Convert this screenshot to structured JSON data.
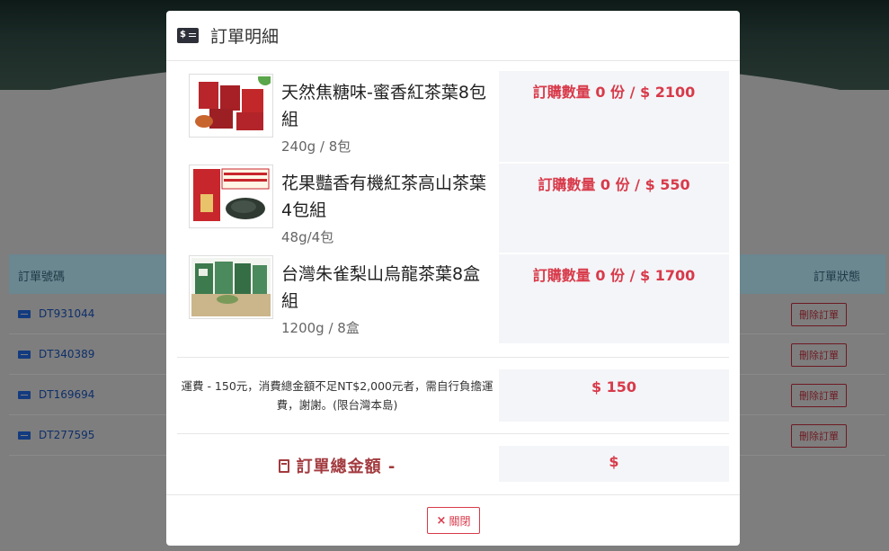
{
  "background": {
    "table_headers": {
      "order_no": "訂單號碼",
      "status": "訂單狀態"
    },
    "rows": [
      {
        "order_no": "DT931044",
        "action": "刪除訂單"
      },
      {
        "order_no": "DT340389",
        "action": "刪除訂單"
      },
      {
        "order_no": "DT169694",
        "action": "刪除訂單"
      },
      {
        "order_no": "DT277595",
        "action": "刪除訂單"
      }
    ]
  },
  "modal": {
    "title": "訂單明細",
    "card_icon_symbol": "$",
    "items": [
      {
        "name": "天然焦糖味-蜜香紅茶葉8包組",
        "spec": "240g / 8包",
        "qty_text": "訂購數量 0 份 / $ 2100",
        "thumb_color": "#c2282a"
      },
      {
        "name": "花果豔香有機紅茶高山茶葉4包組",
        "spec": "48g/4包",
        "qty_text": "訂購數量 0 份 / $ 550",
        "thumb_color": "#c8262d"
      },
      {
        "name": "台灣朱雀梨山烏龍茶葉8盒組",
        "spec": "1200g / 8盒",
        "qty_text": "訂購數量 0 份 / $ 1700",
        "thumb_color": "#3d7a4e"
      }
    ],
    "shipping": {
      "text": "運費 - 150元，消費總金額不足NT$2,000元者，需自行負擔運費，謝謝。(限台灣本島)",
      "amount": "$ 150"
    },
    "total": {
      "label": "訂單總金額 -",
      "amount": "$"
    },
    "close_label": "關閉",
    "close_icon": "×"
  }
}
